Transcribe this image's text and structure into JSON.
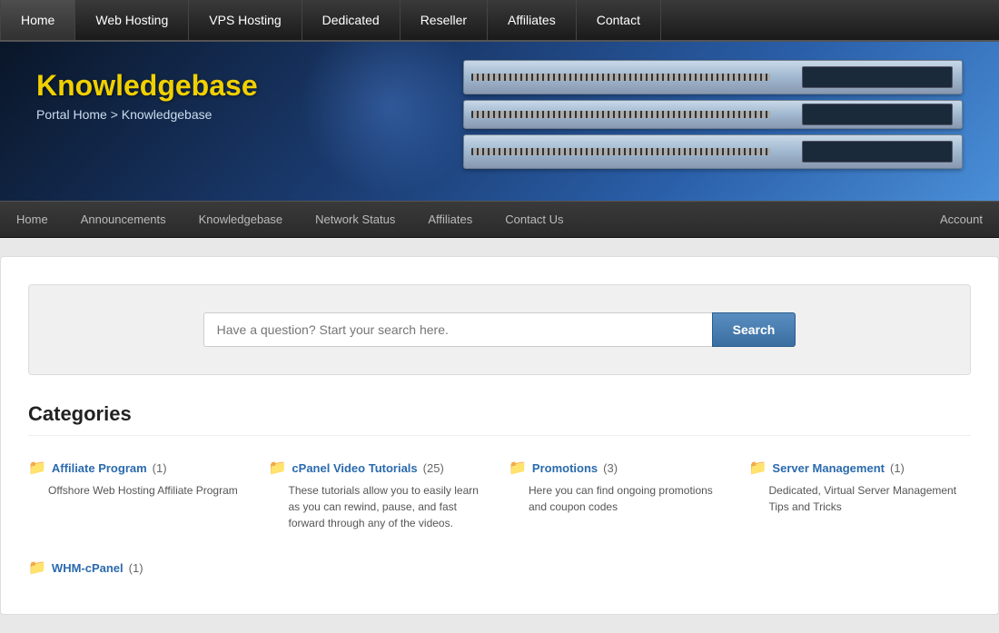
{
  "topNav": {
    "items": [
      {
        "label": "Home",
        "href": "#"
      },
      {
        "label": "Web Hosting",
        "href": "#"
      },
      {
        "label": "VPS Hosting",
        "href": "#"
      },
      {
        "label": "Dedicated",
        "href": "#"
      },
      {
        "label": "Reseller",
        "href": "#"
      },
      {
        "label": "Affiliates",
        "href": "#"
      },
      {
        "label": "Contact",
        "href": "#"
      }
    ]
  },
  "banner": {
    "title": "Knowledgebase",
    "breadcrumb": "Portal Home > Knowledgebase"
  },
  "secNav": {
    "items": [
      {
        "label": "Home",
        "href": "#"
      },
      {
        "label": "Announcements",
        "href": "#"
      },
      {
        "label": "Knowledgebase",
        "href": "#"
      },
      {
        "label": "Network Status",
        "href": "#"
      },
      {
        "label": "Affiliates",
        "href": "#"
      },
      {
        "label": "Contact Us",
        "href": "#"
      },
      {
        "label": "Account",
        "href": "#",
        "align": "right"
      }
    ]
  },
  "search": {
    "placeholder": "Have a question? Start your search here.",
    "button_label": "Search"
  },
  "categories": {
    "title": "Categories",
    "items": [
      {
        "name": "Affiliate Program",
        "count": "(1)",
        "description": "Offshore Web Hosting Affiliate Program"
      },
      {
        "name": "cPanel Video Tutorials",
        "count": "(25)",
        "description": "These tutorials allow you to easily learn as you can rewind, pause, and fast forward through any of the videos."
      },
      {
        "name": "Promotions",
        "count": "(3)",
        "description": "Here you can find ongoing promotions and coupon codes"
      },
      {
        "name": "Server Management",
        "count": "(1)",
        "description": "Dedicated, Virtual Server Management Tips and Tricks"
      },
      {
        "name": "WHM-cPanel",
        "count": "(1)",
        "description": ""
      }
    ]
  }
}
